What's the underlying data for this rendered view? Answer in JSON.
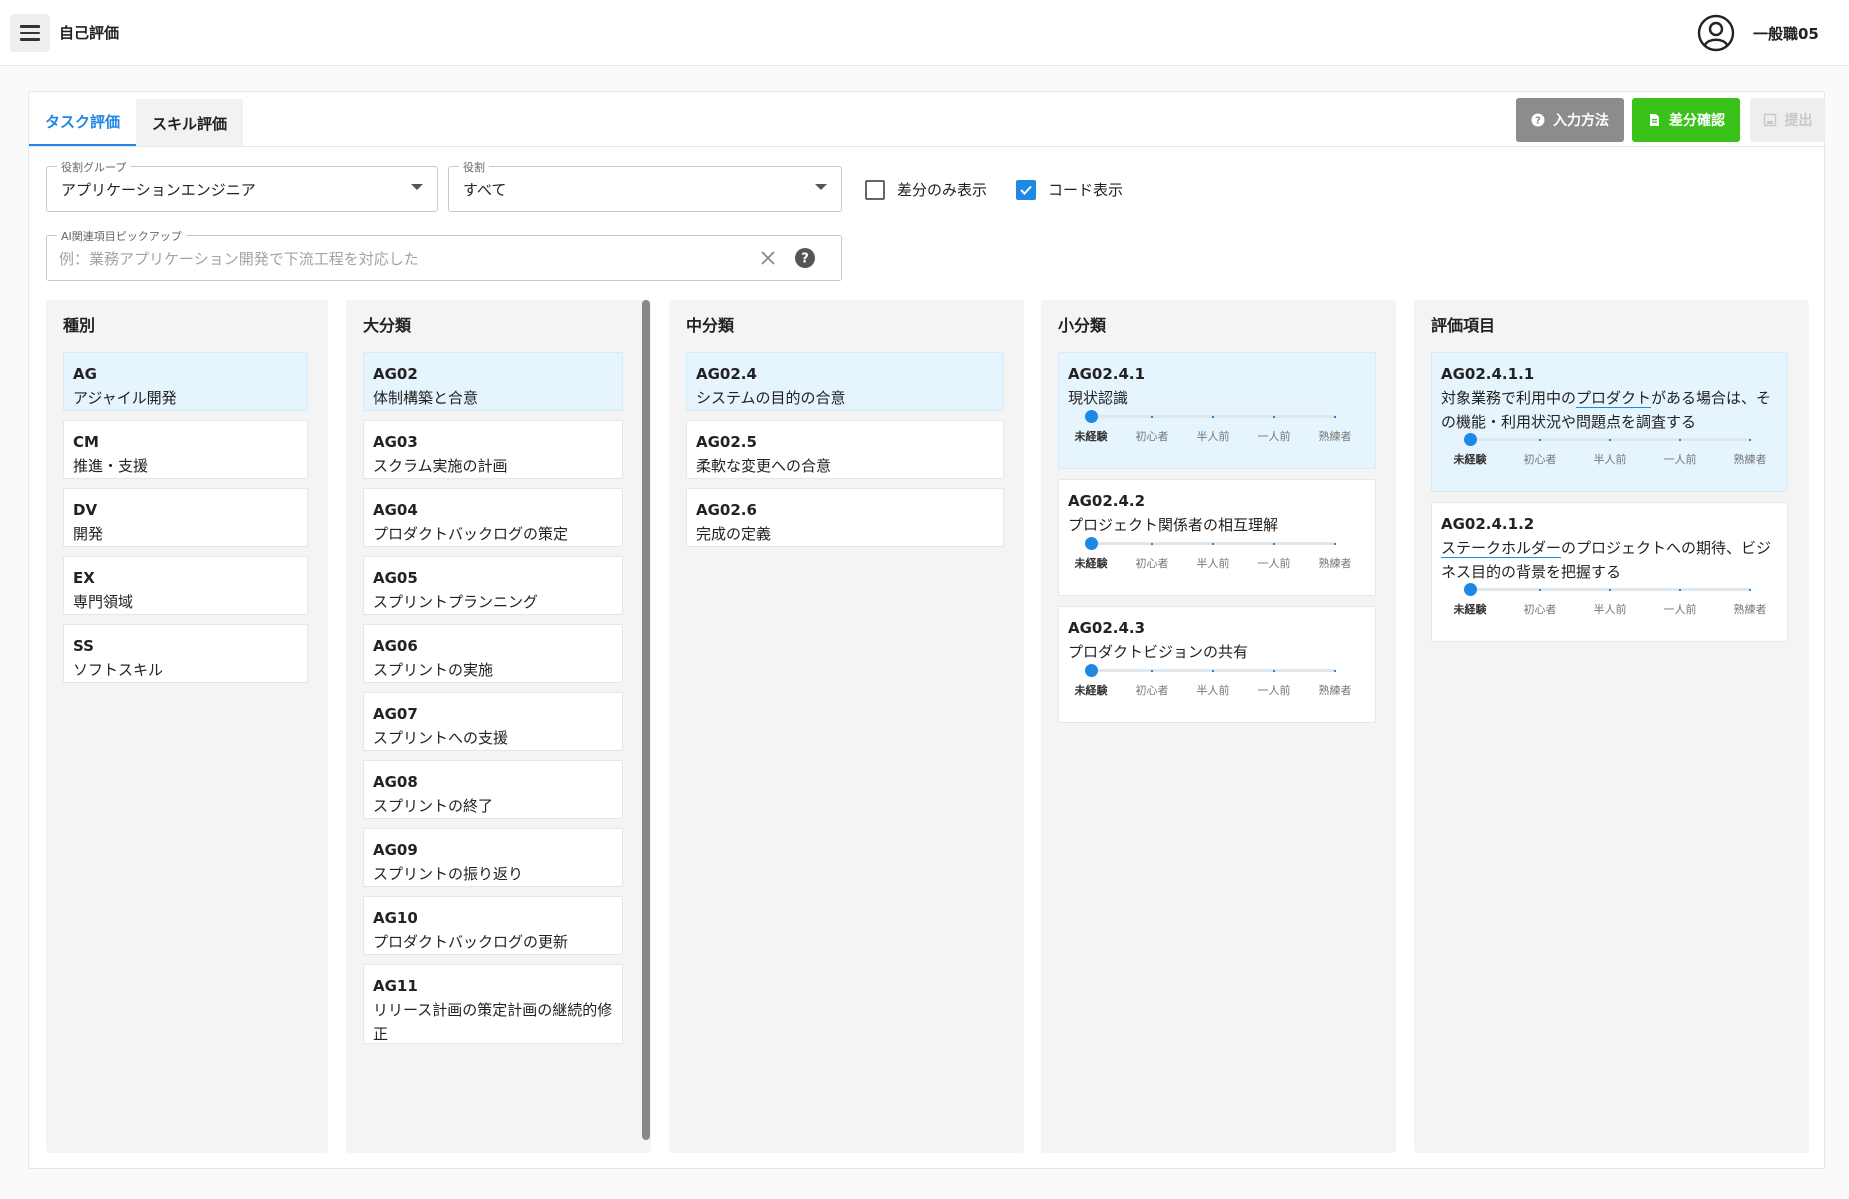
{
  "header": {
    "title": "自己評価",
    "user_name": "一般職05"
  },
  "tabs": [
    {
      "label": "タスク評価",
      "active": true
    },
    {
      "label": "スキル評価",
      "active": false
    }
  ],
  "actions": {
    "help_label": "入力方法",
    "diff_label": "差分確認",
    "submit_label": "提出"
  },
  "filters": {
    "group_label": "役割グループ",
    "group_value": "アプリケーションエンジニア",
    "role_label": "役割",
    "role_value": "すべて",
    "diff_only_label": "差分のみ表示",
    "diff_only_checked": false,
    "code_display_label": "コード表示",
    "code_display_checked": true
  },
  "ai_pickup": {
    "label": "AI関連項目ピックアップ",
    "placeholder": "例：業務アプリケーション開発で下流工程を対応した"
  },
  "levels": [
    "未経験",
    "初心者",
    "半人前",
    "一人前",
    "熟練者"
  ],
  "columns": {
    "category": {
      "title": "種別",
      "items": [
        {
          "code": "AG",
          "name": "アジャイル開発",
          "selected": true
        },
        {
          "code": "CM",
          "name": "推進・支援"
        },
        {
          "code": "DV",
          "name": "開発"
        },
        {
          "code": "EX",
          "name": "専門領域"
        },
        {
          "code": "SS",
          "name": "ソフトスキル"
        }
      ]
    },
    "major": {
      "title": "大分類",
      "items": [
        {
          "code": "AG02",
          "name": "体制構築と合意",
          "selected": true
        },
        {
          "code": "AG03",
          "name": "スクラム実施の計画"
        },
        {
          "code": "AG04",
          "name": "プロダクトバックログの策定"
        },
        {
          "code": "AG05",
          "name": "スプリントプランニング"
        },
        {
          "code": "AG06",
          "name": "スプリントの実施"
        },
        {
          "code": "AG07",
          "name": "スプリントへの支援"
        },
        {
          "code": "AG08",
          "name": "スプリントの終了"
        },
        {
          "code": "AG09",
          "name": "スプリントの振り返り"
        },
        {
          "code": "AG10",
          "name": "プロダクトバックログの更新"
        },
        {
          "code": "AG11",
          "name": "リリース計画の策定計画の継続的修正"
        }
      ]
    },
    "middle": {
      "title": "中分類",
      "items": [
        {
          "code": "AG02.4",
          "name": "システムの目的の合意",
          "selected": true
        },
        {
          "code": "AG02.5",
          "name": "柔軟な変更への合意"
        },
        {
          "code": "AG02.6",
          "name": "完成の定義"
        }
      ]
    },
    "minor": {
      "title": "小分類",
      "items": [
        {
          "code": "AG02.4.1",
          "name": "現状認識",
          "selected": true,
          "level": 0
        },
        {
          "code": "AG02.4.2",
          "name": "プロジェクト関係者の相互理解",
          "level": 0
        },
        {
          "code": "AG02.4.3",
          "name": "プロダクトビジョンの共有",
          "level": 0
        }
      ]
    },
    "eval": {
      "title": "評価項目",
      "items": [
        {
          "code": "AG02.4.1.1",
          "name_pre": "対象業務で利用中の",
          "name_link": "プロダクト",
          "name_post": "がある場合は、その機能・利用状況や問題点を調査する",
          "selected": true,
          "level": 0
        },
        {
          "code": "AG02.4.1.2",
          "name_pre": "",
          "name_link": "ステークホルダー",
          "name_post": "のプロジェクトへの期待、ビジネス目的の背景を把握する",
          "level": 0
        }
      ]
    }
  },
  "colors": {
    "accent": "#1e88e5",
    "selected_bg": "#e5f4fd",
    "help_btn": "#8c8c8c",
    "diff_btn": "#3ac21a",
    "column_bg": "#f4f4f4"
  }
}
